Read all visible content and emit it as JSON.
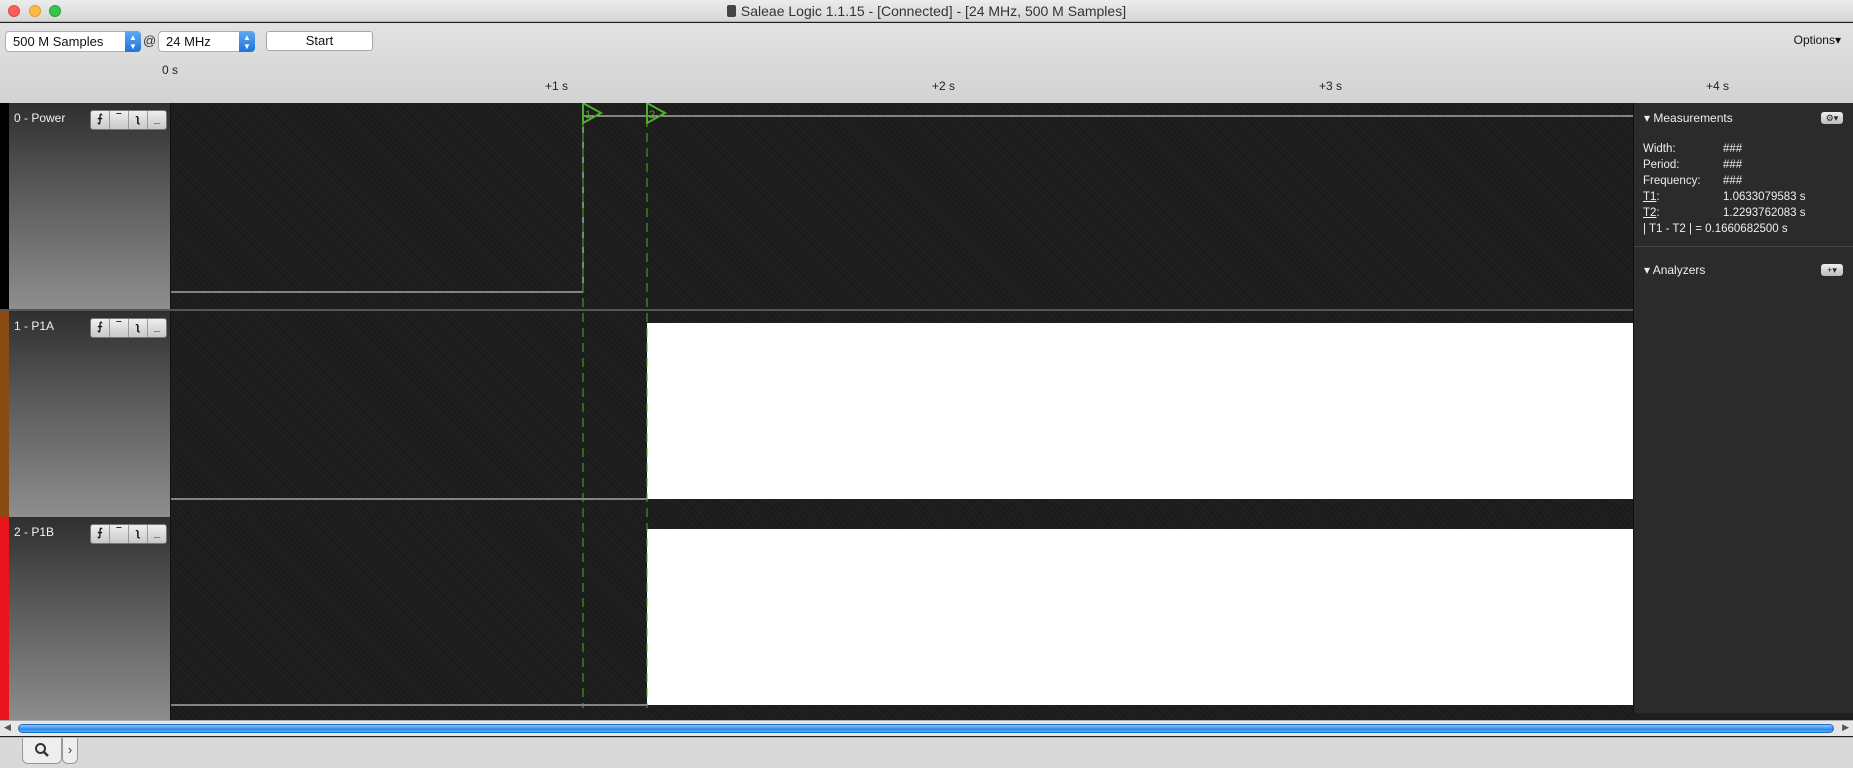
{
  "window": {
    "title": "Saleae Logic 1.1.15 - [Connected] - [24 MHz, 500 M Samples]"
  },
  "toolbar": {
    "samples": "500 M Samples",
    "at": "@",
    "rate": "24 MHz",
    "start_label": "Start",
    "options_label": "Options▾"
  },
  "ruler": {
    "origin": "0 s",
    "ticks": [
      "+1 s",
      "+2 s",
      "+3 s",
      "+4 s"
    ]
  },
  "channels": [
    {
      "name": "0 - Power",
      "color": "#000000"
    },
    {
      "name": "1 - P1A",
      "color": "#8a4b12"
    },
    {
      "name": "2 - P1B",
      "color": "#e8141b"
    }
  ],
  "trigger_buttons": [
    "⨍",
    "‾",
    "ʅ",
    "_"
  ],
  "cursors": {
    "c1": "1",
    "c2": "2",
    "color": "#4caf2a"
  },
  "measurements": {
    "title": "Measurements",
    "width_label": "Width:",
    "width_value": "###",
    "period_label": "Period:",
    "period_value": "###",
    "frequency_label": "Frequency:",
    "frequency_value": "###",
    "t1_label": "T1",
    "t1_value": "1.0633079583 s",
    "t2_label": "T2",
    "t2_value": "1.2293762083 s",
    "diff_label": "| T1 - T2 | =",
    "diff_value": "0.1660682500 s"
  },
  "analyzers": {
    "title": "Analyzers"
  },
  "icons": {
    "panel_gear": "gear-icon",
    "add_analyzer": "plus-icon",
    "search_tab": "search-icon",
    "expand_tab": "chevron-right-icon"
  }
}
